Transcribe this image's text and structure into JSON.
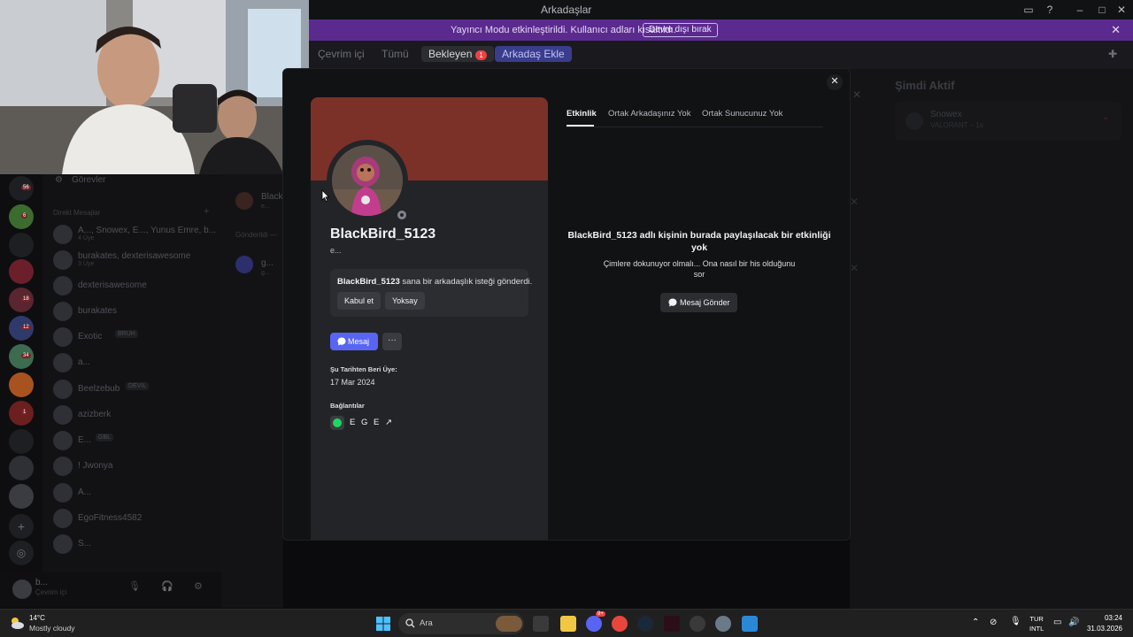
{
  "window": {
    "title": "Arkadaşlar"
  },
  "banner": {
    "message": "Yayıncı Modu etkinleştirildi. Kullanıcı adları kısaltıldı.",
    "button": "Devre dışı bırak"
  },
  "friends_tabs": {
    "online": "Çevrim içi",
    "all": "Tümü",
    "pending": "Bekleyen",
    "pending_count": "1",
    "add_friend": "Arkadaş Ekle"
  },
  "sidebar": {
    "tasks": "Görevler",
    "dm_header": "Direkt Mesajlar",
    "dm_items": [
      {
        "name": "A..., Snowex, E..., Yunus Emre, b...",
        "sub": "4 Üye"
      },
      {
        "name": "burakates, dexterisawesome",
        "sub": "3 Üye"
      },
      {
        "name": "dexterisawesome",
        "sub": ""
      },
      {
        "name": "burakates",
        "sub": ""
      },
      {
        "name": "Exotic",
        "sub": "",
        "tag": "BRUH"
      },
      {
        "name": "a...",
        "sub": ""
      },
      {
        "name": "Beelzebub",
        "sub": "",
        "tag": "DEVIL"
      },
      {
        "name": "azizberk",
        "sub": ""
      },
      {
        "name": "E...",
        "sub": "",
        "tag": "GBL"
      },
      {
        "name": "! Jwonya",
        "sub": ""
      },
      {
        "name": "A...",
        "sub": ""
      },
      {
        "name": "EgoFitness4582",
        "sub": ""
      },
      {
        "name": "S...",
        "sub": ""
      }
    ],
    "server_badges": [
      "56",
      "6",
      "18",
      "12",
      "34",
      "1"
    ]
  },
  "friends_column": {
    "pending_name": "Black...",
    "pending_sub": "e...",
    "sent_header": "Gönderildi —",
    "sent_name": "g...",
    "sent_sub": "g..."
  },
  "user_panel": {
    "name": "b...",
    "status": "Çevrim içi"
  },
  "profile": {
    "username": "BlackBird_5123",
    "pronouns": "e...",
    "request_name": "BlackBird_5123",
    "request_text": "sana bir arkadaşlık isteği gönderdi.",
    "accept": "Kabul et",
    "ignore": "Yoksay",
    "message_button": "Mesaj",
    "more": "···",
    "member_since_label": "Şu Tarihten Beri Üye:",
    "member_since": "17 Mar 2024",
    "connections_label": "Bağlantılar",
    "connection_name": "E G E ↗"
  },
  "modal_tabs": {
    "activity": "Etkinlik",
    "mutual_friends": "Ortak Arkadaşınız Yok",
    "mutual_servers": "Ortak Sunucunuz Yok"
  },
  "empty_state": {
    "title": "BlackBird_5123 adlı kişinin burada paylaşılacak bir etkinliği yok",
    "subtitle": "Çimlere dokunuyor olmalı... Ona nasıl bir his olduğunu sor",
    "button": "Mesaj Gönder"
  },
  "now_active": {
    "title": "Şimdi Aktif",
    "user": "Snowex",
    "game": "VALORANT – 1s"
  },
  "taskbar": {
    "temperature": "14°C",
    "weather": "Mostly cloudy",
    "search_placeholder": "Ara",
    "lang_top": "TUR",
    "lang_bottom": "INTL",
    "time": "03:24",
    "date": "31.03.2026",
    "discord_badge": "9+"
  },
  "colors": {
    "accent": "#5865f2",
    "banner": "#5b2a8f",
    "profile_banner": "#7b3127",
    "spotify": "#1ed760",
    "danger": "#f23f43"
  }
}
